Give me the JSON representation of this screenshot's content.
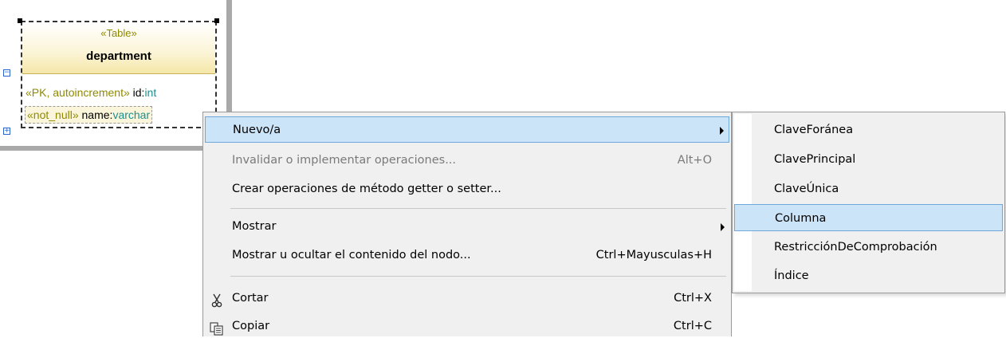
{
  "diagram": {
    "table": {
      "stereotype": "«Table»",
      "name": "department",
      "columns": [
        {
          "stereotype": "«PK, autoincrement»",
          "name": " id",
          "type_sep": ":",
          "type": "int"
        },
        {
          "stereotype": "«not_null»",
          "name": " name",
          "type_sep": ":",
          "type": "varchar"
        }
      ]
    }
  },
  "context_menu": {
    "items": [
      {
        "label": "Nuevo/a",
        "shortcut": "",
        "has_submenu": true,
        "state": "highlighted"
      },
      {
        "label": "Invalidar o implementar operaciones...",
        "shortcut": "Alt+O",
        "state": "disabled"
      },
      {
        "label": "Crear operaciones de método getter o setter...",
        "shortcut": ""
      },
      {
        "label": "Mostrar",
        "shortcut": "",
        "has_submenu": true
      },
      {
        "label": "Mostrar u ocultar el contenido del nodo...",
        "shortcut": "Ctrl+Mayusculas+H"
      },
      {
        "label": "Cortar",
        "shortcut": "Ctrl+X",
        "icon": "scissors-icon"
      },
      {
        "label": "Copiar",
        "shortcut": "Ctrl+C",
        "icon": "copy-icon"
      }
    ]
  },
  "submenu": {
    "items": [
      {
        "label": "ClaveForánea"
      },
      {
        "label": "ClavePrincipal"
      },
      {
        "label": "ClaveÚnica"
      },
      {
        "label": "Columna",
        "state": "highlighted"
      },
      {
        "label": "RestricciónDeComprobación"
      },
      {
        "label": "Índice"
      }
    ]
  },
  "colors": {
    "highlight": "#cce4f7",
    "highlight_border": "#6ea7da",
    "menu_background": "#f0f0f0",
    "stereotype_text": "#8e8a00",
    "type_text": "#1b8f8f"
  }
}
